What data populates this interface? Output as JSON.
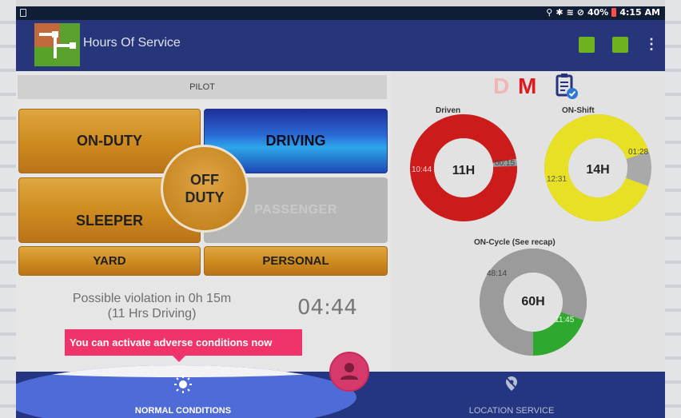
{
  "status_bar": {
    "battery": "40%",
    "time": "4:15 AM"
  },
  "app": {
    "title": "Hours Of Service"
  },
  "duty": {
    "pilot_label": "PILOT",
    "on_duty": "ON-DUTY",
    "driving": "DRIVING",
    "sleeper": "SLEEPER",
    "passenger": "PASSENGER",
    "off_duty_line1": "OFF",
    "off_duty_line2": "DUTY",
    "yard": "YARD",
    "personal": "PERSONAL"
  },
  "violation": {
    "line1": "Possible violation in 0h 15m",
    "line2": "(11 Hrs Driving)",
    "timer": "04:44"
  },
  "dm": {
    "d": "D",
    "m": "M"
  },
  "rings": {
    "driven": {
      "title": "Driven",
      "center": "11H",
      "left": "10:44",
      "right": "00:15",
      "used": 10.73,
      "remaining": 0.25,
      "color": "#cc1b1b",
      "rest_color": "#9a9a9a"
    },
    "on_shift": {
      "title": "ON-Shift",
      "center": "14H",
      "left": "12:31",
      "right": "01:28",
      "used": 12.52,
      "remaining": 1.47,
      "color": "#e7e024",
      "rest_color": "#a9a9a9"
    },
    "on_cycle": {
      "title": "ON-Cycle (See recap)",
      "center": "60H",
      "left": "48:14",
      "right": "11:45",
      "used": 48.23,
      "remaining": 11.75,
      "color": "#9b9b9b",
      "rest_color": "#2ea82e"
    }
  },
  "tooltip": {
    "text": "You can activate adverse conditions now"
  },
  "bottom": {
    "normal": "NORMAL CONDITIONS",
    "location": "LOCATION SERVICE"
  },
  "colors": {
    "appbar": "#27367a",
    "accent": "#f0336a"
  }
}
